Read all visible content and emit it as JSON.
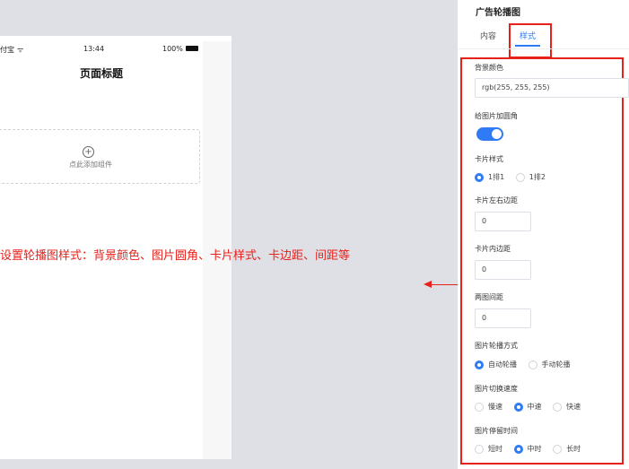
{
  "status_bar": {
    "carrier": "付宝",
    "wifi_icon": "wifi-icon",
    "time": "13:44",
    "battery": "100%"
  },
  "phone": {
    "page_title": "页面标题",
    "add_component": "点此添加组件"
  },
  "annotation": {
    "text": "设置轮播图样式：背景颜色、图片圆角、卡片样式、卡边距、间距等"
  },
  "panel": {
    "title": "广告轮播图",
    "tabs": [
      {
        "label": "内容"
      },
      {
        "label": "样式"
      }
    ],
    "bg_color": {
      "label": "背景颜色",
      "value": "rgb(255, 255, 255)"
    },
    "radius": {
      "label": "给图片加圆角",
      "enabled": true
    },
    "card_style": {
      "label": "卡片样式",
      "options": [
        "1排1",
        "1排2"
      ],
      "selected": 0
    },
    "card_lr_margin": {
      "label": "卡片左右边距",
      "value": "0"
    },
    "card_padding": {
      "label": "卡片内边距",
      "value": "0"
    },
    "image_gap": {
      "label": "两图间距",
      "value": "0"
    },
    "carousel_mode": {
      "label": "图片轮播方式",
      "options": [
        "自动轮播",
        "手动轮播"
      ],
      "selected": 0
    },
    "switch_speed": {
      "label": "图片切换速度",
      "options": [
        "慢速",
        "中速",
        "快速"
      ],
      "selected": 1
    },
    "stay_time": {
      "label": "图片停留时间",
      "options": [
        "短时",
        "中时",
        "长时"
      ],
      "selected": 1
    }
  },
  "colors": {
    "accent": "#2f7bf5",
    "annotation_red": "#e8201a",
    "canvas_bg": "#dfe0e5"
  }
}
